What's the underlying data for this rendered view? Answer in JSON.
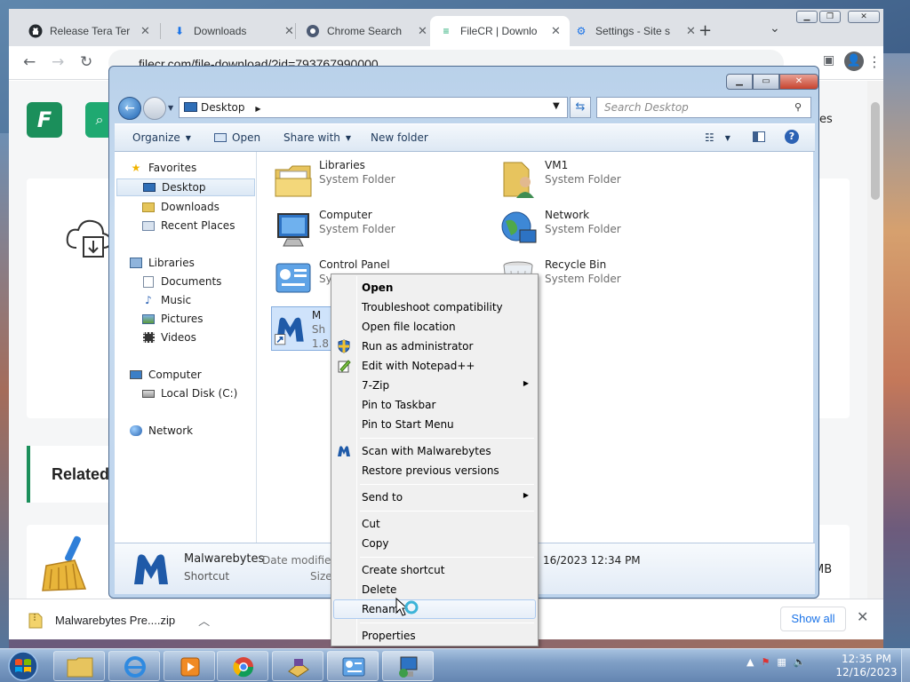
{
  "chrome": {
    "tabs": [
      {
        "label": "Release Tera Ter",
        "icon": "github-icon"
      },
      {
        "label": "Downloads",
        "icon": "download-icon"
      },
      {
        "label": "Chrome Search",
        "icon": "chrome-search-icon"
      },
      {
        "label": "FileCR | Downlo",
        "icon": "filecr-icon"
      },
      {
        "label": "Settings - Site s",
        "icon": "settings-gear-icon"
      }
    ],
    "url": "filecr.com/file-download/?id=793767990000"
  },
  "webpage": {
    "logo_letter": "F",
    "right_text": "es",
    "related_heading": "Related",
    "right_size": "MB"
  },
  "download_bar": {
    "filename": "Malwarebytes Pre....zip",
    "show_all": "Show all"
  },
  "explorer": {
    "address": "Desktop",
    "search_placeholder": "Search Desktop",
    "commands": {
      "organize": "Organize",
      "open": "Open",
      "share_with": "Share with",
      "new_folder": "New folder"
    },
    "nav": {
      "favorites": "Favorites",
      "desktop": "Desktop",
      "downloads": "Downloads",
      "recent_places": "Recent Places",
      "libraries": "Libraries",
      "documents": "Documents",
      "music": "Music",
      "pictures": "Pictures",
      "videos": "Videos",
      "computer": "Computer",
      "local_disk": "Local Disk (C:)",
      "network": "Network"
    },
    "items": {
      "libraries": {
        "name": "Libraries",
        "type": "System Folder"
      },
      "vm1": {
        "name": "VM1",
        "type": "System Folder"
      },
      "computer": {
        "name": "Computer",
        "type": "System Folder"
      },
      "network": {
        "name": "Network",
        "type": "System Folder"
      },
      "control_panel": {
        "name": "Control Panel",
        "type": "Sy"
      },
      "recycle_bin": {
        "name": "Recycle Bin",
        "type": "System Folder"
      },
      "malwarebytes": {
        "name": "M",
        "type": "Sh",
        "size": "1.8"
      }
    },
    "details": {
      "name": "Malwarebytes",
      "type": "Shortcut",
      "modified_label": "Date modified:",
      "size_label": "Size:",
      "date": "16/2023 12:34 PM"
    }
  },
  "context_menu": {
    "open": "Open",
    "troubleshoot": "Troubleshoot compatibility",
    "open_location": "Open file location",
    "run_admin": "Run as administrator",
    "edit_npp": "Edit with Notepad++",
    "sevenzip": "7-Zip",
    "pin_taskbar": "Pin to Taskbar",
    "pin_start": "Pin to Start Menu",
    "scan_mb": "Scan with Malwarebytes",
    "restore_prev": "Restore previous versions",
    "send_to": "Send to",
    "cut": "Cut",
    "copy": "Copy",
    "create_shortcut": "Create shortcut",
    "delete": "Delete",
    "rename": "Renam",
    "properties": "Properties"
  },
  "taskbar": {
    "time": "12:35 PM",
    "date": "12/16/2023"
  },
  "colors": {
    "filecr_green": "#1b8f5b",
    "chrome_tab_bg": "#dee1e6",
    "menu_hover": "#aecbf0"
  }
}
